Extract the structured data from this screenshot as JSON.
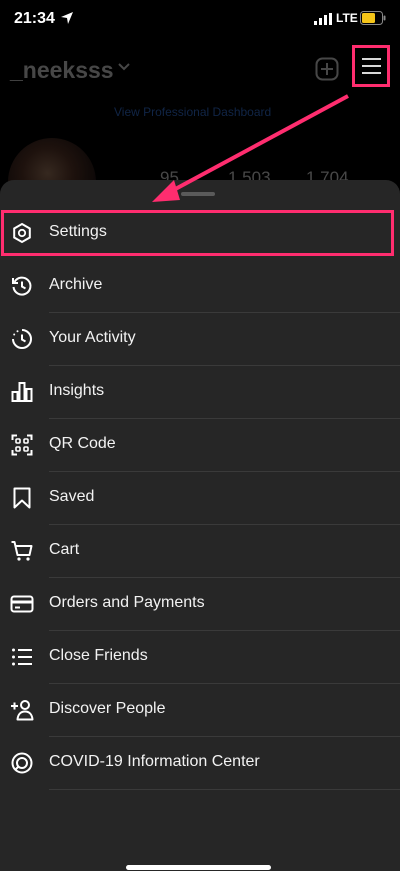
{
  "status_bar": {
    "time": "21:34",
    "network": "LTE"
  },
  "profile": {
    "username": "_neeksss",
    "dashboard_link": "View Professional Dashboard",
    "stats": [
      "95",
      "1,503",
      "1,704"
    ]
  },
  "menu": {
    "items": [
      {
        "label": "Settings",
        "icon": "gear-icon"
      },
      {
        "label": "Archive",
        "icon": "archive-icon"
      },
      {
        "label": "Your Activity",
        "icon": "activity-icon"
      },
      {
        "label": "Insights",
        "icon": "insights-icon"
      },
      {
        "label": "QR Code",
        "icon": "qr-code-icon"
      },
      {
        "label": "Saved",
        "icon": "bookmark-icon"
      },
      {
        "label": "Cart",
        "icon": "cart-icon"
      },
      {
        "label": "Orders and Payments",
        "icon": "card-icon"
      },
      {
        "label": "Close Friends",
        "icon": "list-icon"
      },
      {
        "label": "Discover People",
        "icon": "add-person-icon"
      },
      {
        "label": "COVID-19 Information Center",
        "icon": "covid-info-icon"
      }
    ]
  },
  "colors": {
    "highlight": "#ff2d6f",
    "sheet": "#262626",
    "link": "#3b82f6"
  }
}
